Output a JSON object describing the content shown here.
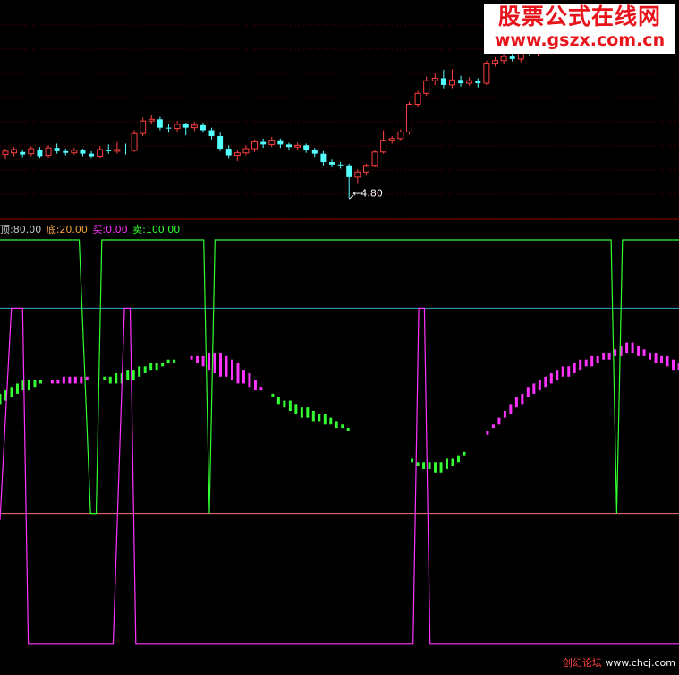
{
  "watermark": {
    "title": "股票公式在线网",
    "url": "www.gszx.com.cn"
  },
  "footer": {
    "forum": "创幻论坛",
    "site": "www.chcj.com"
  },
  "legend": {
    "top_label": "顶:80.00",
    "bottom_label": "底:20.00",
    "buy_label": "买:0.00",
    "sell_label": "卖:100.00"
  },
  "colors": {
    "candle_up": "#ff4040",
    "candle_down": "#54ffff",
    "fill_up": "#ff33ff",
    "fill_down": "#33ff33",
    "buy_line": "#ff33ff",
    "sell_line": "#33ff33",
    "level_top": "#3aa6c4",
    "level_bottom": "#f07878",
    "grid": "#5a0000"
  },
  "chart_data": [
    {
      "type": "candlestick",
      "annotation": "4.80",
      "low_point_value": 4.8,
      "candles": [
        [
          5.32,
          5.36,
          5.26,
          5.39
        ],
        [
          5.34,
          5.38,
          5.3,
          5.41
        ],
        [
          5.35,
          5.32,
          5.29,
          5.38
        ],
        [
          5.33,
          5.39,
          5.3,
          5.42
        ],
        [
          5.38,
          5.3,
          5.27,
          5.41
        ],
        [
          5.31,
          5.4,
          5.28,
          5.43
        ],
        [
          5.4,
          5.36,
          5.33,
          5.45
        ],
        [
          5.36,
          5.34,
          5.31,
          5.39
        ],
        [
          5.34,
          5.37,
          5.32,
          5.4
        ],
        [
          5.37,
          5.33,
          5.3,
          5.39
        ],
        [
          5.33,
          5.3,
          5.27,
          5.36
        ],
        [
          5.3,
          5.38,
          5.28,
          5.42
        ],
        [
          5.38,
          5.36,
          5.33,
          5.44
        ],
        [
          5.36,
          5.38,
          5.33,
          5.47
        ],
        [
          5.38,
          5.37,
          5.32,
          5.45
        ],
        [
          5.37,
          5.57,
          5.35,
          5.61
        ],
        [
          5.57,
          5.72,
          5.54,
          5.76
        ],
        [
          5.72,
          5.74,
          5.68,
          5.79
        ],
        [
          5.74,
          5.64,
          5.61,
          5.77
        ],
        [
          5.64,
          5.63,
          5.58,
          5.68
        ],
        [
          5.63,
          5.68,
          5.59,
          5.72
        ],
        [
          5.68,
          5.64,
          5.55,
          5.7
        ],
        [
          5.64,
          5.67,
          5.6,
          5.71
        ],
        [
          5.67,
          5.61,
          5.58,
          5.7
        ],
        [
          5.61,
          5.54,
          5.5,
          5.64
        ],
        [
          5.54,
          5.39,
          5.36,
          5.58
        ],
        [
          5.39,
          5.31,
          5.27,
          5.43
        ],
        [
          5.31,
          5.34,
          5.24,
          5.37
        ],
        [
          5.34,
          5.39,
          5.31,
          5.43
        ],
        [
          5.39,
          5.47,
          5.35,
          5.5
        ],
        [
          5.47,
          5.44,
          5.4,
          5.51
        ],
        [
          5.44,
          5.49,
          5.41,
          5.53
        ],
        [
          5.49,
          5.44,
          5.4,
          5.51
        ],
        [
          5.44,
          5.41,
          5.37,
          5.46
        ],
        [
          5.41,
          5.43,
          5.38,
          5.46
        ],
        [
          5.43,
          5.38,
          5.34,
          5.45
        ],
        [
          5.38,
          5.33,
          5.29,
          5.4
        ],
        [
          5.33,
          5.23,
          5.19,
          5.36
        ],
        [
          5.23,
          5.2,
          5.17,
          5.26
        ],
        [
          5.2,
          5.19,
          5.15,
          5.23
        ],
        [
          5.19,
          5.05,
          4.8,
          5.21
        ],
        [
          5.05,
          5.11,
          4.98,
          5.14
        ],
        [
          5.11,
          5.19,
          5.08,
          5.21
        ],
        [
          5.19,
          5.35,
          5.17,
          5.38
        ],
        [
          5.35,
          5.49,
          5.33,
          5.61
        ],
        [
          5.49,
          5.51,
          5.45,
          5.54
        ],
        [
          5.51,
          5.59,
          5.49,
          5.62
        ],
        [
          5.59,
          5.92,
          5.56,
          5.95
        ],
        [
          5.92,
          6.05,
          5.89,
          6.08
        ],
        [
          6.05,
          6.2,
          6.02,
          6.25
        ],
        [
          6.2,
          6.23,
          6.15,
          6.29
        ],
        [
          6.23,
          6.15,
          6.11,
          6.33
        ],
        [
          6.15,
          6.21,
          6.11,
          6.34
        ],
        [
          6.21,
          6.17,
          6.13,
          6.26
        ],
        [
          6.17,
          6.2,
          6.14,
          6.24
        ],
        [
          6.2,
          6.17,
          6.12,
          6.23
        ],
        [
          6.17,
          6.41,
          6.15,
          6.44
        ],
        [
          6.41,
          6.44,
          6.37,
          6.48
        ],
        [
          6.44,
          6.49,
          6.4,
          6.53
        ],
        [
          6.49,
          6.46,
          6.43,
          6.55
        ],
        [
          6.46,
          6.56,
          6.42,
          6.59
        ],
        [
          6.56,
          6.53,
          6.49,
          6.6
        ],
        [
          6.53,
          6.57,
          6.49,
          6.62
        ],
        [
          6.57,
          6.61,
          6.53,
          6.65
        ],
        [
          6.61,
          6.73,
          6.58,
          6.76
        ],
        [
          6.73,
          6.82,
          6.7,
          6.85
        ],
        [
          6.82,
          6.86,
          6.77,
          6.89
        ],
        [
          6.86,
          6.92,
          6.82,
          6.95
        ],
        [
          6.92,
          6.95,
          6.87,
          6.98
        ],
        [
          6.95,
          6.9,
          6.85,
          6.98
        ],
        [
          6.9,
          6.91,
          6.86,
          6.95
        ],
        [
          6.91,
          6.87,
          6.83,
          6.96
        ],
        [
          6.87,
          6.78,
          6.75,
          6.9
        ],
        [
          6.78,
          6.82,
          6.75,
          6.88
        ],
        [
          6.82,
          6.89,
          6.79,
          6.92
        ],
        [
          6.89,
          6.85,
          6.81,
          6.93
        ]
      ]
    },
    {
      "type": "indicator",
      "ylim": [
        0,
        100
      ],
      "levels": {
        "top": 80,
        "bottom": 20
      },
      "curves": {
        "fast": [
          52,
          53,
          54,
          55,
          56,
          56,
          57,
          58,
          58,
          59,
          59,
          60,
          60,
          60,
          60,
          60,
          59,
          59,
          59,
          58,
          58,
          58,
          59,
          59,
          60,
          61,
          62,
          62,
          63,
          64,
          64,
          65,
          65,
          66,
          66,
          66,
          67,
          67,
          67,
          66,
          65,
          64,
          62,
          61,
          59,
          57,
          55,
          54,
          52,
          51,
          50,
          49,
          48,
          48,
          47,
          47,
          46,
          46,
          45,
          45,
          44,
          44,
          44,
          43,
          42,
          41,
          40,
          39,
          38,
          37,
          36,
          35,
          34,
          33,
          33,
          32,
          32,
          33,
          34,
          35,
          37,
          39,
          41,
          42,
          44,
          46,
          48,
          50,
          52,
          54,
          55,
          57,
          58,
          59,
          60,
          61,
          62,
          63,
          63,
          64,
          65,
          65,
          66,
          66,
          67,
          67,
          68,
          69,
          70,
          70,
          69,
          68,
          67,
          67,
          66,
          66,
          65,
          64
        ],
        "slow": [
          55,
          56,
          57,
          58,
          59,
          59,
          59,
          59,
          58,
          58,
          58,
          58,
          58,
          58,
          58,
          59,
          59,
          59,
          60,
          60,
          61,
          61,
          62,
          62,
          63,
          63,
          64,
          64,
          64,
          65,
          65,
          65,
          65,
          65,
          64,
          63,
          62,
          61,
          60,
          60,
          59,
          58,
          58,
          57,
          56,
          56,
          55,
          55,
          54,
          53,
          53,
          52,
          51,
          51,
          50,
          49,
          49,
          48,
          47,
          46,
          45,
          44,
          44,
          43,
          42,
          41,
          40,
          39,
          38,
          37,
          36,
          36,
          35,
          35,
          35,
          35,
          35,
          36,
          36,
          37,
          38,
          39,
          41,
          42,
          43,
          45,
          46,
          48,
          49,
          51,
          52,
          54,
          55,
          56,
          57,
          58,
          59,
          60,
          60,
          61,
          62,
          63,
          63,
          64,
          65,
          65,
          66,
          66,
          67,
          67,
          66,
          66,
          65,
          64,
          64,
          63,
          62,
          62
        ]
      },
      "buy_signal": {
        "points": [
          [
            0,
            18
          ],
          [
            2,
            80
          ],
          [
            4,
            80
          ],
          [
            5,
            -18
          ],
          [
            20,
            -18
          ],
          [
            22,
            80
          ],
          [
            23,
            80
          ],
          [
            24,
            -18
          ],
          [
            73,
            -18
          ],
          [
            74,
            80
          ],
          [
            75,
            80
          ],
          [
            76,
            -18
          ],
          [
            120,
            -18
          ]
        ]
      },
      "sell_signal": {
        "points": [
          [
            0,
            100
          ],
          [
            14,
            100
          ],
          [
            16,
            20
          ],
          [
            17,
            20
          ],
          [
            18,
            100
          ],
          [
            36,
            100
          ],
          [
            37,
            20
          ],
          [
            38,
            100
          ],
          [
            108,
            100
          ],
          [
            109,
            20
          ],
          [
            110,
            100
          ],
          [
            114,
            100
          ],
          [
            115,
            100
          ],
          [
            120,
            100
          ]
        ]
      }
    }
  ]
}
